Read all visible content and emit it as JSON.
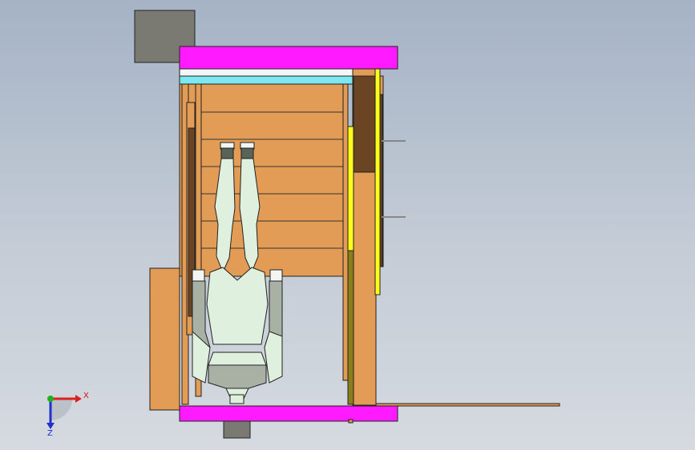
{
  "view": {
    "background_top": "#a5b3c6",
    "background_bottom": "#d6dae0"
  },
  "colors": {
    "wood": "#e39c55",
    "wood_dark": "#6b4423",
    "magenta": "#ff1aff",
    "cyan": "#7de8ef",
    "yellow": "#ffff1a",
    "olive": "#8a7d1c",
    "gray_block": "#7a7a72",
    "figure_light": "#dff0df",
    "figure_gray": "#a9b0a4",
    "figure_boot": "#5a6358"
  },
  "triad": {
    "x_label": "X",
    "z_label": "Z",
    "x_color": "#dd2020",
    "y_color": "#20b020",
    "z_color": "#2030cc"
  }
}
